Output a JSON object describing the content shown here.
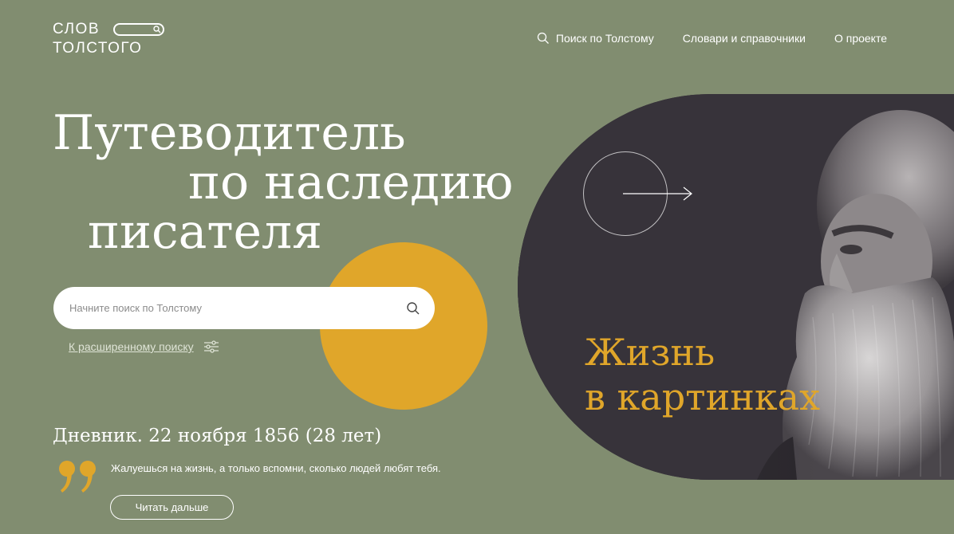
{
  "logo": {
    "line1": "СЛОВ",
    "line2": "ТОЛСТОГО"
  },
  "nav": {
    "search_label": "Поиск по Толстому",
    "dictionaries_label": "Словари и справочники",
    "about_label": "О проекте"
  },
  "hero": {
    "line1": "Путеводитель",
    "line2": "по наследию",
    "line3": "писателя"
  },
  "search": {
    "placeholder": "Начните поиск по Толстому",
    "value": "",
    "advanced_label": "К расширенному поиску"
  },
  "diary": {
    "title": "Дневник. 22 ноября 1856 (28 лет)",
    "quote": "Жалуешься на жизнь, а только вспомни, сколько людей любят тебя.",
    "read_more_label": "Читать дальше"
  },
  "feature": {
    "line1": "Жизнь",
    "line2": "в картинках"
  },
  "colors": {
    "background": "#818d70",
    "accent": "#e0a62a",
    "panel": "#37333a",
    "white": "#ffffff"
  },
  "icons": {
    "nav_search": "search-icon",
    "search_button": "search-icon",
    "advanced": "filter-sliders-icon",
    "quote": "quote-icon",
    "arrow": "arrow-right-icon"
  }
}
